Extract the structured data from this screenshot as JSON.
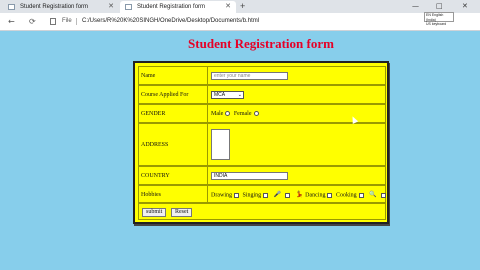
{
  "browser": {
    "tabs": [
      {
        "label": "Student Registration form",
        "active": false
      },
      {
        "label": "Student Registration form",
        "active": true
      }
    ],
    "new_tab_symbol": "+",
    "window_buttons": [
      "—",
      "□",
      "✕"
    ],
    "nav": {
      "back": "←",
      "reload": "⟳"
    },
    "file_label": "File",
    "url": "C:/Users/R%20K%20SINGH/OneDrive/Desktop/Documents/b.html",
    "language_popup": [
      "EN English (India)",
      "US keyboard"
    ]
  },
  "page": {
    "title": "Student Registration form",
    "title_color": "#e60026",
    "background": "#87ceeb",
    "form_background": "#ffff00"
  },
  "form": {
    "name": {
      "label": "Name",
      "placeholder": "enter your name"
    },
    "course": {
      "label": "Course Applied For",
      "selected": "MCA"
    },
    "gender": {
      "label": "GENDER",
      "options": [
        "Male",
        "Female"
      ]
    },
    "address": {
      "label": "ADDRESS"
    },
    "country": {
      "label": "COUNTRY",
      "value": "INDIA"
    },
    "hobbies": {
      "label": "Hobbies",
      "options": [
        "Drawing",
        "Singing",
        "Dancing",
        "Cooking"
      ]
    },
    "buttons": {
      "submit": "submit",
      "reset": "Reset"
    }
  }
}
